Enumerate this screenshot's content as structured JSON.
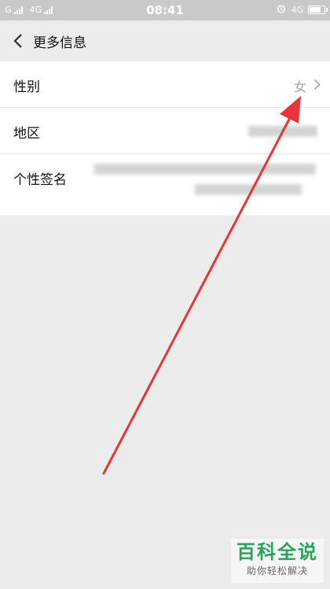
{
  "status_bar": {
    "carrier1": "G",
    "carrier2": "4G",
    "time": "08:41",
    "network_right": "4G",
    "battery_level": 0.85
  },
  "header": {
    "back_icon": "chevron-left-icon",
    "title": "更多信息"
  },
  "rows": [
    {
      "label": "性别",
      "value": "女",
      "icon": "chevron-right-icon"
    },
    {
      "label": "地区",
      "value": "",
      "icon": "chevron-right-icon"
    },
    {
      "label": "个性签名",
      "value": ""
    }
  ],
  "annotation": {
    "arrow_color": "#e8343b"
  },
  "watermark": {
    "main": "百科全说",
    "sub": "助你轻松解决",
    "color": "#27a35a"
  }
}
